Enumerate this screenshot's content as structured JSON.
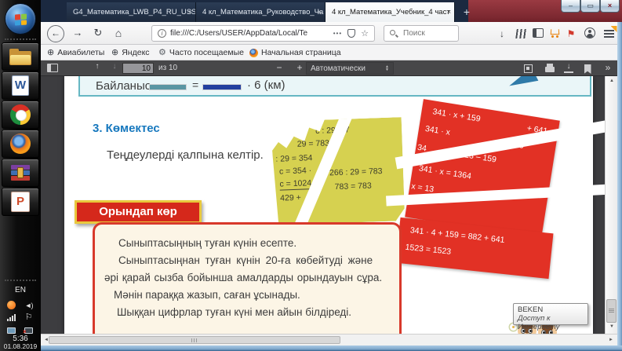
{
  "taskbar": {
    "apps": [
      {
        "name": "windows-explorer"
      },
      {
        "name": "microsoft-word",
        "letter": "W"
      },
      {
        "name": "google-chrome"
      },
      {
        "name": "mozilla-firefox"
      },
      {
        "name": "winrar"
      },
      {
        "name": "microsoft-powerpoint",
        "letter": "P"
      }
    ],
    "language": "EN",
    "time": "5:36",
    "date": "01.08.2019"
  },
  "browser": {
    "tabs": [
      {
        "label": "G4_Математика_LWB_P4_RU_USS.p",
        "close": "×"
      },
      {
        "label": "4 кл_Математика_Руководство_Ча",
        "close": "×"
      },
      {
        "label": "4 кл_Математика_Учебник_4 част",
        "close": "×"
      }
    ],
    "new_tab_label": "+",
    "window_controls": {
      "minimize": "–",
      "maximize": "▭",
      "close": "×"
    },
    "nav": {
      "back": "←",
      "forward": "→",
      "reload": "↻",
      "home": "⌂",
      "info": "i",
      "url": "file:///C:/Users/USER/AppData/Local/Te",
      "more": "•••",
      "star": "☆",
      "search_placeholder": "Поиск",
      "download": "↓"
    },
    "bookmarks": [
      "Авиабилеты",
      "Яндекс",
      "Часто посещаемые",
      "Начальная страница"
    ],
    "globe_glyph": "⊕",
    "gear_glyph": "⚙"
  },
  "pdf_toolbar": {
    "up": "↑",
    "down": "↓",
    "page_value": "10",
    "page_total": "из 10",
    "minus": "−",
    "plus": "+",
    "zoom_mode": "Автоматически",
    "spin_up": "▲",
    "spin_down": "▼",
    "download": "↓",
    "more": "»"
  },
  "scroll": {
    "up": "▲",
    "down": "▼",
    "left": "◄",
    "right": "►"
  },
  "page": {
    "relation": {
      "label": "Байланыс",
      "equals": "=",
      "multiplier": "· 6 (км)"
    },
    "section_title": "3. Көмектес",
    "instruction": "Теңдеулерді қалпына келтір.",
    "yellow_note_lines": [
      "c : 29 = 7",
      "29 = 783 –",
      ": 29 = 354",
      "c = 354 ·",
      "c = 1024",
      "429 +",
      "266 : 29 = 783",
      "783 = 783"
    ],
    "red_note_fragments": [
      "341 · x + 159",
      "+ 641",
      "341 · x",
      "523",
      "34",
      "x = 1523 – 159",
      "341 · x = 1364",
      "x = 13"
    ],
    "red_note2_lines": [
      "341 · 4 + 159 = 882 + 641",
      "1523 = 1523"
    ],
    "badge_label": "Орындап көр",
    "task_lines": [
      "Сыныптасыңның туған күнін есепте.",
      "Сыныптасыңнан туған күнін 20-ға көбейтуді және",
      "әрі қарай сызба бойынша амалдарды орындауын сұра.",
      "Мәнін параққа жазып, саған ұсынады.",
      "Шыққан цифрлар туған күні мен айын білдіреді."
    ]
  },
  "tooltip": {
    "title": "BEKEN",
    "subtitle": "Доступ к Интернету"
  },
  "colors": {
    "note_yellow": "#d6d150",
    "note_red": "#e23125",
    "badge_red": "#d5281b",
    "heading_blue": "#1778be",
    "relation_border": "#66b7c3"
  }
}
